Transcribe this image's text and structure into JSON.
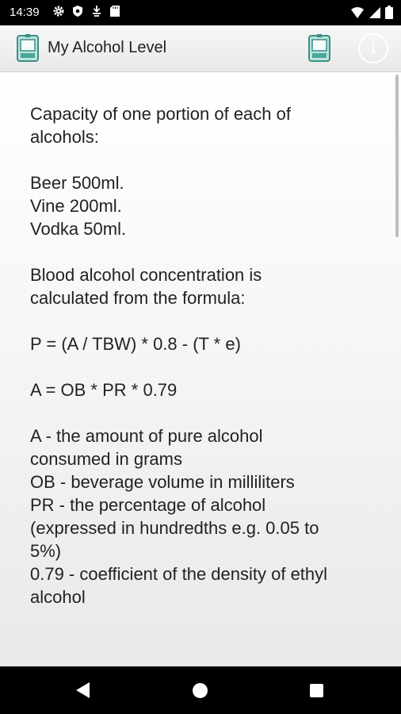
{
  "status_bar": {
    "time": "14:39",
    "left_icons": [
      "gear-icon",
      "shield-icon",
      "cloud-download-icon",
      "sd-card-icon"
    ],
    "right_icons": [
      "wifi-icon",
      "signal-icon",
      "battery-icon"
    ]
  },
  "app_bar": {
    "title": "My Alcohol Level",
    "icon": "app-logo-icon",
    "action_icon": "calculator-icon",
    "info_icon": "info-icon",
    "info_glyph": "i"
  },
  "content": {
    "capacity_heading_1": "Capacity of one portion of each of",
    "capacity_heading_2": "alcohols:",
    "beer": "Beer 500ml.",
    "vine": "Vine 200ml.",
    "vodka": "Vodka 50ml.",
    "bac_line_1": "Blood alcohol concentration is",
    "bac_line_2": "calculated from the formula:",
    "formula_p": "P = (A / TBW) * 0.8 - (T * e)",
    "formula_a": "A = OB * PR * 0.79",
    "def_a_1": "A - the amount of pure alcohol",
    "def_a_2": "consumed in grams",
    "def_ob": "OB - beverage volume in milliliters",
    "def_pr_1": "PR - the percentage of alcohol",
    "def_pr_2": "(expressed in hundredths e.g. 0.05 to",
    "def_pr_3": "5%)",
    "def_079_1": "0.79 - coefficient of the density of ethyl",
    "def_079_2": "alcohol"
  },
  "nav_bar": {
    "back_icon": "back-icon",
    "home_icon": "home-icon",
    "recents_icon": "recents-icon"
  },
  "colors": {
    "status_bar": "#000000",
    "app_bar": "#efefef",
    "text": "#222222"
  }
}
